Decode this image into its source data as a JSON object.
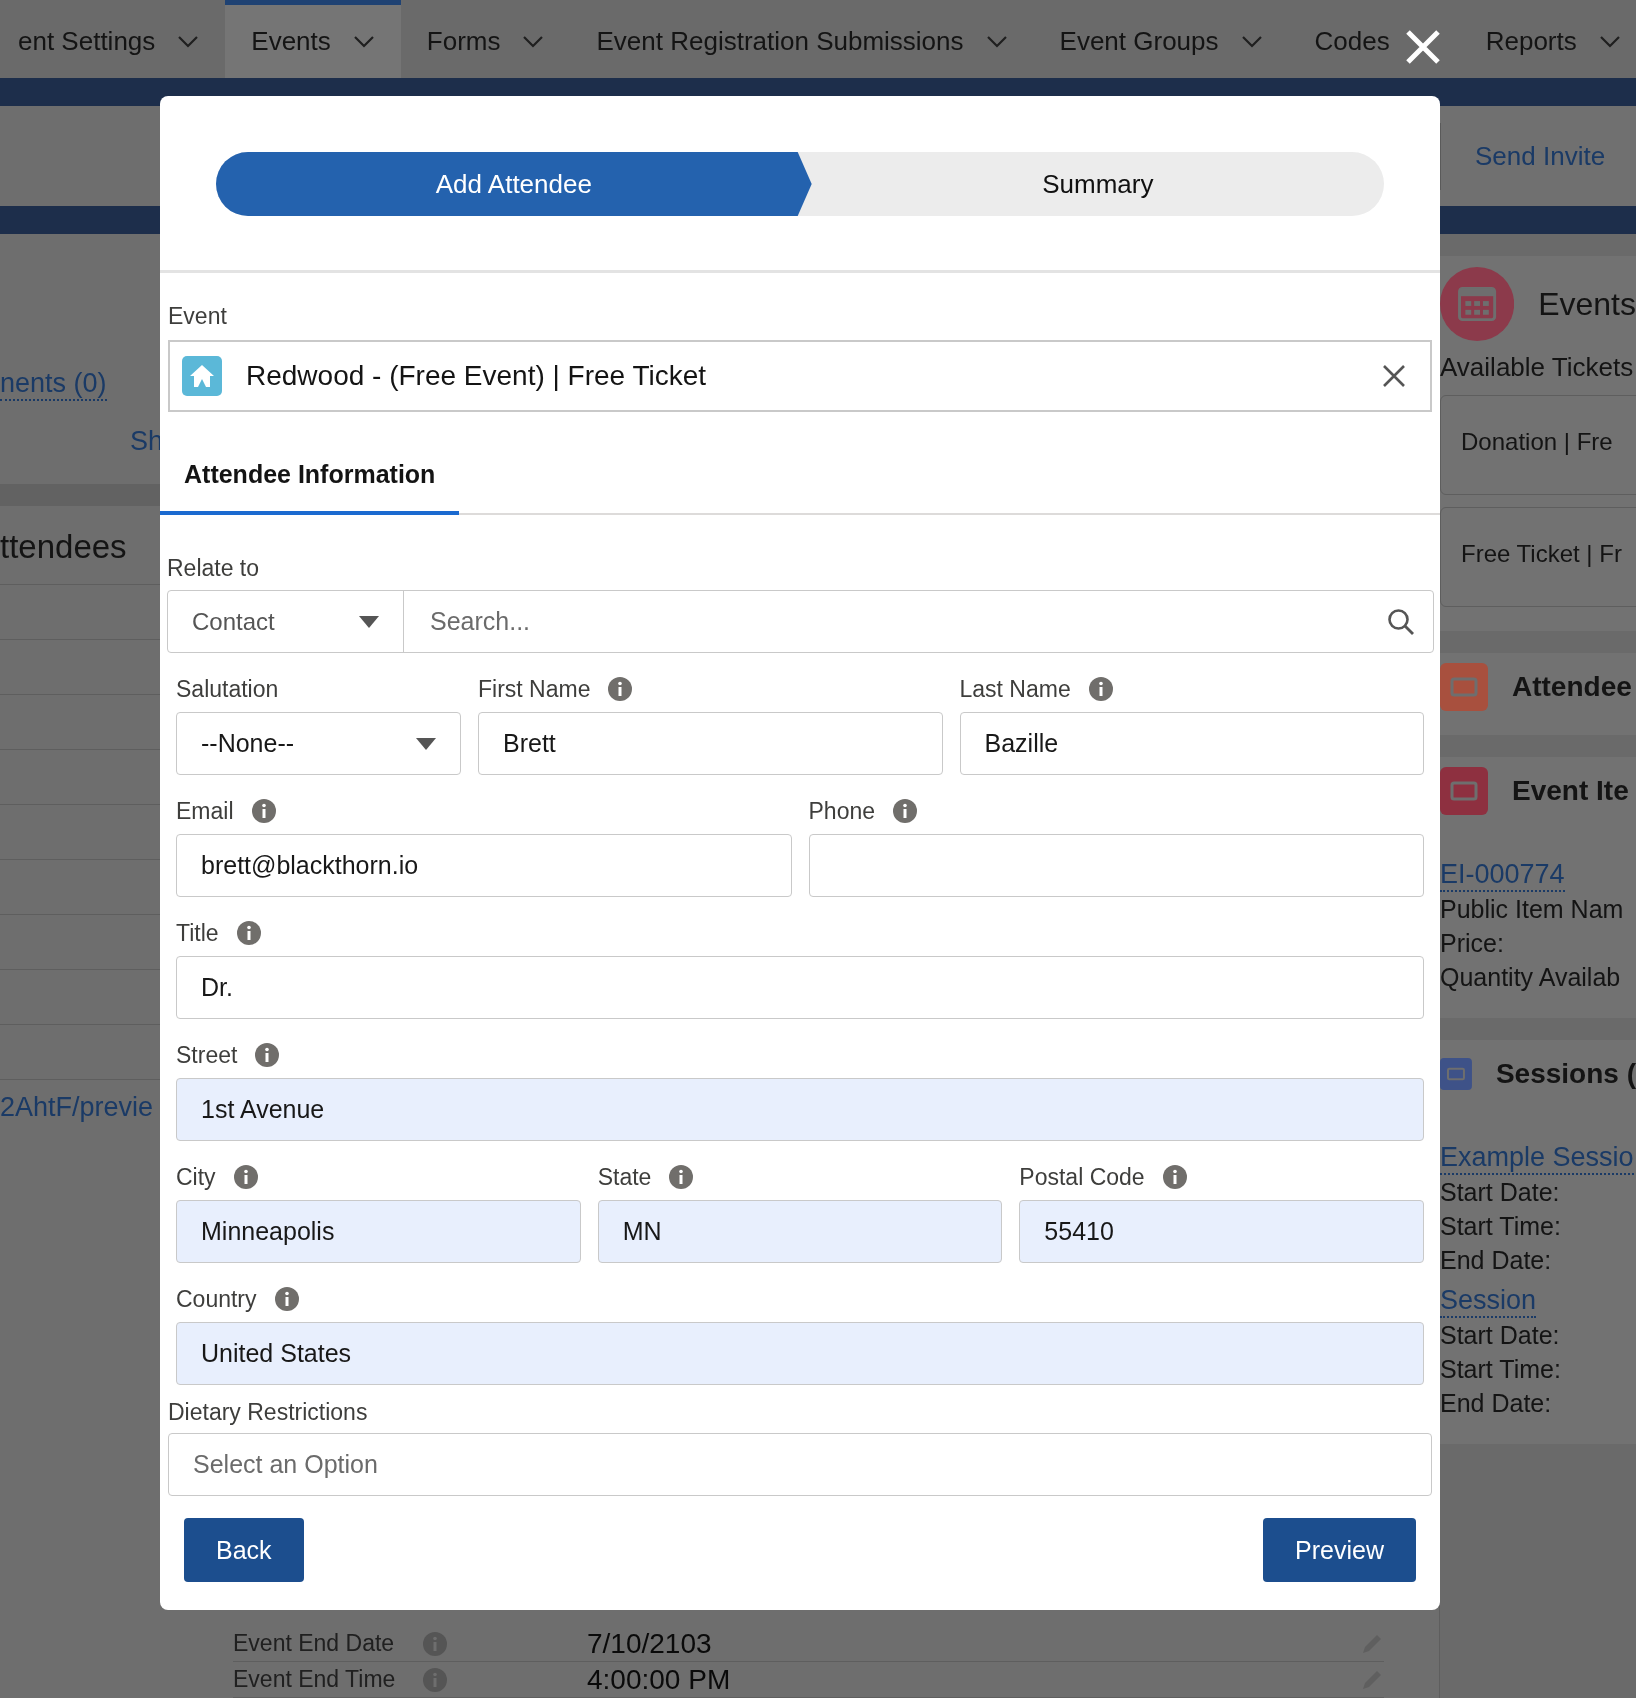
{
  "nav": {
    "items": [
      {
        "label": "ent Settings",
        "selected": false,
        "has_menu": true
      },
      {
        "label": "Events",
        "selected": true,
        "has_menu": true
      },
      {
        "label": "Forms",
        "selected": false,
        "has_menu": true
      },
      {
        "label": "Event Registration Submissions",
        "selected": false,
        "has_menu": true
      },
      {
        "label": "Event Groups",
        "selected": false,
        "has_menu": true
      },
      {
        "label": "Codes",
        "selected": false,
        "has_menu": false
      },
      {
        "label": "Reports",
        "selected": false,
        "has_menu": true
      }
    ]
  },
  "left_panel": {
    "link": "nents (0)",
    "short_link": "Sh",
    "heading": "ttendees",
    "url": "2AhtF/previe"
  },
  "right_panel": {
    "send_button": "Send Invite",
    "cards": [
      {
        "kind": "tickets",
        "title": "Events",
        "color": "#8c3a4b",
        "subtitle": "Available Tickets",
        "tickets": [
          "Donation | Fre",
          "Free Ticket | Fr"
        ]
      },
      {
        "kind": "header",
        "title": "Attendee",
        "color": "#a8503e"
      },
      {
        "kind": "records",
        "title": "Event Ite",
        "color": "#8e3040",
        "records": [
          {
            "link": "EI-000774",
            "lines": [
              "Public Item Nam",
              "Price:",
              "Quantity Availab"
            ]
          }
        ]
      },
      {
        "kind": "records",
        "title": "Sessions (",
        "color": "#3e5288",
        "records": [
          {
            "link": "Example Sessio",
            "lines": [
              "Start Date:",
              "Start Time:",
              "End Date:"
            ]
          },
          {
            "link": "Session",
            "lines": [
              "Start Date:",
              "Start Time:",
              "End Date:"
            ]
          }
        ]
      }
    ]
  },
  "detail_rows": [
    {
      "label": "Event End Date",
      "info": true,
      "value": "7/10/2103"
    },
    {
      "label": "Event End Time",
      "info": true,
      "value": "4:00:00 PM"
    }
  ],
  "modal": {
    "steps": [
      {
        "label": "Add Attendee",
        "selected": true
      },
      {
        "label": "Summary",
        "selected": false
      }
    ],
    "event": {
      "label": "Event",
      "value": "Redwood - (Free Event) | Free Ticket"
    },
    "tabs": [
      {
        "label": "Attendee Information",
        "selected": true
      }
    ],
    "relate_to": {
      "label": "Relate to",
      "type": "Contact",
      "placeholder": "Search..."
    },
    "rows": [
      [
        {
          "kind": "select",
          "label": "Salutation",
          "info": false,
          "value": "--None--",
          "autofilled": false
        },
        {
          "kind": "text",
          "label": "First Name",
          "info": true,
          "value": "Brett",
          "autofilled": false
        },
        {
          "kind": "text",
          "label": "Last Name",
          "info": true,
          "value": "Bazille",
          "autofilled": false
        }
      ],
      [
        {
          "kind": "text",
          "label": "Email",
          "info": true,
          "value": "brett@blackthorn.io",
          "autofilled": false
        },
        {
          "kind": "text",
          "label": "Phone",
          "info": true,
          "autofilled": false
        }
      ],
      [
        {
          "kind": "text",
          "label": "Title",
          "info": true,
          "value": "Dr.",
          "autofilled": false
        }
      ],
      [
        {
          "kind": "text",
          "label": "Street",
          "info": true,
          "value": "1st Avenue",
          "autofilled": true
        }
      ],
      [
        {
          "kind": "text",
          "label": "City",
          "info": true,
          "value": "Minneapolis",
          "autofilled": true
        },
        {
          "kind": "text",
          "label": "State",
          "info": true,
          "value": "MN",
          "autofilled": true
        },
        {
          "kind": "text",
          "label": "Postal Code",
          "info": true,
          "value": "55410",
          "autofilled": true
        }
      ],
      [
        {
          "kind": "text",
          "label": "Country",
          "info": true,
          "value": "United States",
          "autofilled": true
        }
      ]
    ],
    "dietary": {
      "label": "Dietary Restrictions",
      "placeholder": "Select an Option"
    },
    "buttons": [
      "Back",
      "Preview"
    ]
  }
}
